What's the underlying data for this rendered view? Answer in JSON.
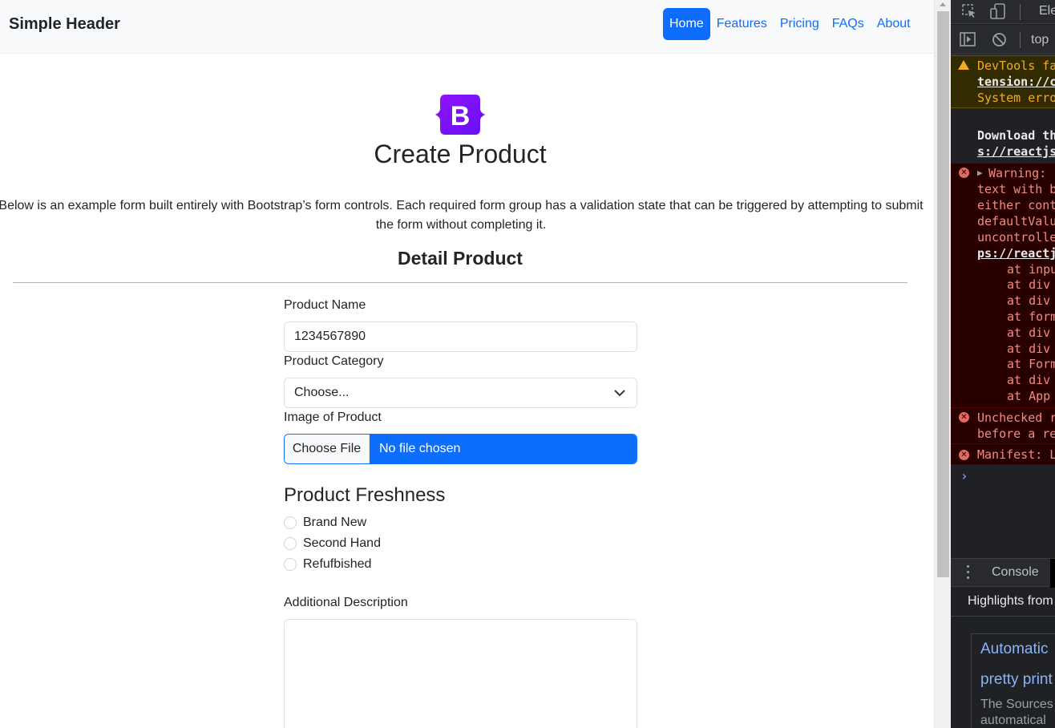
{
  "navbar": {
    "brand": "Simple Header",
    "links": [
      "Home",
      "Features",
      "Pricing",
      "FAQs",
      "About"
    ]
  },
  "logo": {
    "letter": "B"
  },
  "page": {
    "title": "Create Product",
    "lead_line1": "Below is an example form built entirely with Bootstrap’s form controls. Each required form group has a validation state that can be triggered by attempting to submit",
    "lead_line2": "the form without completing it.",
    "section_title": "Detail Product"
  },
  "form": {
    "product_name_label": "Product Name",
    "product_name_value": "1234567890",
    "category_label": "Product Category",
    "category_value": "Choose...",
    "image_label": "Image of Product",
    "file_button": "Choose File",
    "file_status": "No file chosen",
    "freshness_title": "Product Freshness",
    "freshness_options": [
      "Brand New",
      "Second Hand",
      "Refufbished"
    ],
    "description_label": "Additional Description"
  },
  "devtools": {
    "tab_elements": "Ele",
    "context": "top",
    "warn_lines": [
      "DevTools fa",
      "tension://c",
      "System erro"
    ],
    "download_lines": [
      "Download th",
      "s://reactjs"
    ],
    "error1_lines": [
      "Warning:",
      "text with b",
      "either cont",
      "defaultValu",
      "uncontrolle",
      "ps://reactj"
    ],
    "stack_lines": [
      "at inpu",
      "at div",
      "at div",
      "at form",
      "at div",
      "at div",
      "at Form",
      "at div",
      "at App"
    ],
    "error2_lines": [
      "Unchecked r",
      "before a re"
    ],
    "error3_line": "Manifest: L",
    "drawer_tab": "Console",
    "highlights": "Highlights from",
    "card_link1": "Automatic",
    "card_link2": "pretty print",
    "card_text1": "The Sources",
    "card_text2": "automatical"
  },
  "colors": {
    "primary": "#0d6efd",
    "bootstrap_purple": "#7952b3",
    "devtools_bg": "#202124",
    "error_bg": "#290000",
    "warning_bg": "#332b00"
  }
}
